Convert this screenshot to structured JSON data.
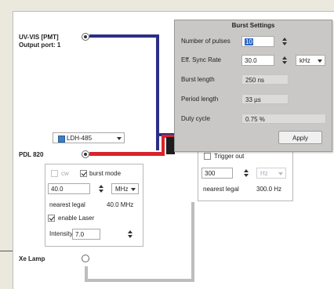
{
  "colors": {
    "uv_wire": "#2c2f86",
    "pdl_wire": "#d9232a",
    "xe_wire": "#bdbdbd",
    "dark_wire": "#1d1d1d"
  },
  "uv_vis": {
    "title": "UV-VIS [PMT]",
    "subtitle": "Output port: 1"
  },
  "laser_select": {
    "value": "LDH-485",
    "icon": "ldh-laser-icon"
  },
  "pdl": {
    "title": "PDL 820",
    "cw_label": "cw",
    "cw_checked": false,
    "burst_label": "burst mode",
    "burst_checked": true,
    "frequency": "40.0",
    "freq_unit": "MHz",
    "nearest_label": "nearest legal",
    "nearest_value": "40.0 MHz",
    "enable_label": "enable Laser",
    "enable_checked": true,
    "intensity_label": "Intensity",
    "intensity": "7.0"
  },
  "trigger": {
    "trigger_out_label": "Trigger out",
    "trigger_out_checked": false,
    "rate": "300",
    "rate_unit": "Hz",
    "nearest_label": "nearest legal",
    "nearest_value": "300.0 Hz"
  },
  "xe_lamp": {
    "title": "Xe Lamp"
  },
  "burst_settings": {
    "title": "Burst Settings",
    "pulses_label": "Number of pulses",
    "pulses_value": "10",
    "sync_label": "Eff. Sync Rate",
    "sync_value": "30.0",
    "sync_unit": "kHz",
    "burst_len_label": "Burst length",
    "burst_len_value": "250 ns",
    "period_label": "Period length",
    "period_value": "33 µs",
    "duty_label": "Duty cycle",
    "duty_value": "0.75 %",
    "apply_label": "Apply"
  }
}
